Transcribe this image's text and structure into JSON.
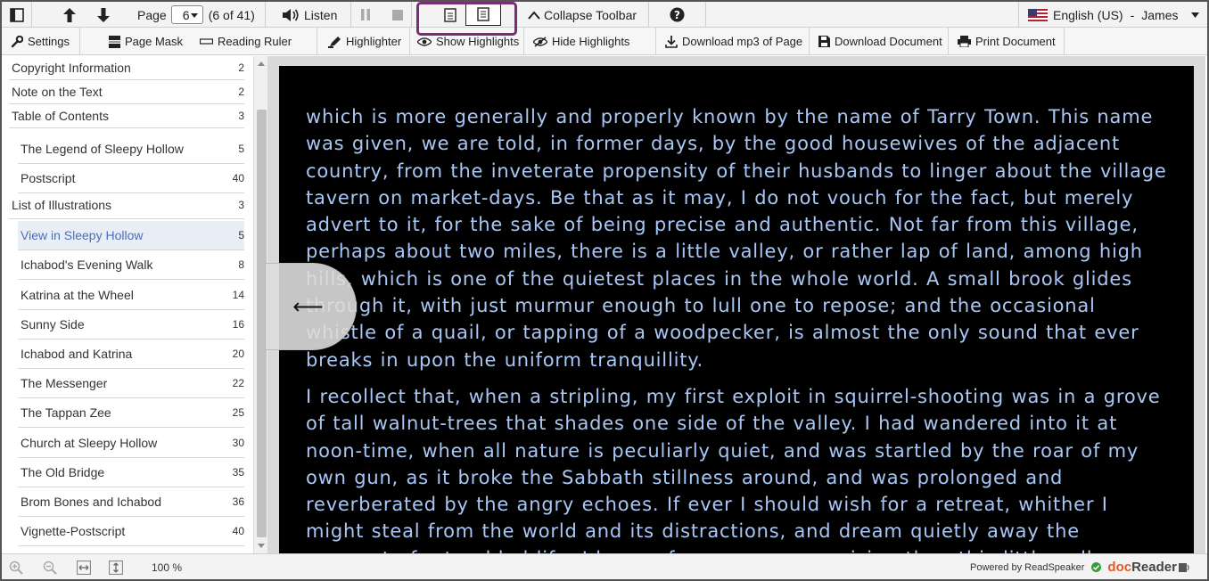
{
  "toolbar": {
    "page_label": "Page",
    "page_value": "6",
    "page_of": "(6 of 41)",
    "listen_label": "Listen",
    "collapse_label": "Collapse Toolbar",
    "language_label": "English (US)",
    "language_sep": "-",
    "voice_label": "James"
  },
  "toolbar2": {
    "settings_label": "Settings",
    "page_mask_label": "Page Mask",
    "reading_ruler_label": "Reading Ruler",
    "highlighter_label": "Highlighter",
    "show_highlights_label": "Show Highlights",
    "hide_highlights_label": "Hide Highlights",
    "download_mp3_label": "Download mp3 of Page",
    "download_doc_label": "Download Document",
    "print_doc_label": "Print Document"
  },
  "toc": [
    {
      "label": "Copyright Information",
      "page": "2",
      "indent": false,
      "active": false
    },
    {
      "label": "Note on the Text",
      "page": "2",
      "indent": false,
      "active": false
    },
    {
      "label": "Table of Contents",
      "page": "3",
      "indent": false,
      "active": false
    },
    {
      "label": "The Legend of Sleepy Hollow",
      "page": "5",
      "indent": true,
      "active": false
    },
    {
      "label": "Postscript",
      "page": "40",
      "indent": true,
      "active": false
    },
    {
      "label": "List of Illustrations",
      "page": "3",
      "indent": false,
      "active": false
    },
    {
      "label": "View in Sleepy Hollow",
      "page": "5",
      "indent": true,
      "active": true
    },
    {
      "label": "Ichabod's Evening Walk",
      "page": "8",
      "indent": true,
      "active": false
    },
    {
      "label": "Katrina at the Wheel",
      "page": "14",
      "indent": true,
      "active": false
    },
    {
      "label": "Sunny Side",
      "page": "16",
      "indent": true,
      "active": false
    },
    {
      "label": "Ichabod and Katrina",
      "page": "20",
      "indent": true,
      "active": false
    },
    {
      "label": "The Messenger",
      "page": "22",
      "indent": true,
      "active": false
    },
    {
      "label": "The Tappan Zee",
      "page": "25",
      "indent": true,
      "active": false
    },
    {
      "label": "Church at Sleepy Hollow",
      "page": "30",
      "indent": true,
      "active": false
    },
    {
      "label": "The Old Bridge",
      "page": "35",
      "indent": true,
      "active": false
    },
    {
      "label": "Brom Bones and Ichabod",
      "page": "36",
      "indent": true,
      "active": false
    },
    {
      "label": "Vignette-Postscript",
      "page": "40",
      "indent": true,
      "active": false
    }
  ],
  "reader": {
    "paragraph1": "which is more generally and properly known by the name of Tarry Town. This name was given, we are told, in former days, by the good housewives of the adjacent country, from the inveterate propensity of their husbands to linger about the village tavern on market-days. Be that as it may, I do not vouch for the fact, but merely advert to it, for the sake of being precise and authentic. Not far from this village, perhaps about two miles, there is a little valley, or rather lap of land, among high hills, which is one of the quietest places in the whole world. A small brook glides through it, with just murmur enough to lull one to repose; and the occasional whistle of a quail, or tapping of a woodpecker, is almost the only sound that ever breaks in upon the uniform tranquillity.",
    "paragraph2": "I recollect that, when a stripling, my first exploit in squirrel-shooting was in a grove of tall walnut-trees that shades one side of the valley. I had wandered into it at noon-time, when all nature is peculiarly quiet, and was startled by the roar of my own gun, as it broke the Sabbath stillness around, and was prolonged and reverberated by the angry echoes. If ever I should wish for a retreat, whither I might steal from the world and its distractions, and dream quietly away the remnant of a troubled life, I know of none more promising than this little valley.",
    "collapse_arrow": "⟵"
  },
  "bottom": {
    "zoom": "100 %",
    "powered_by": "Powered by ReadSpeaker",
    "brand_doc": "doc",
    "brand_reader": "Reader"
  },
  "colors": {
    "highlight_box": "#7b2c77",
    "reader_text": "#a9c7f5",
    "reader_bg": "#000000",
    "active_toc": "#4b6fb5"
  }
}
